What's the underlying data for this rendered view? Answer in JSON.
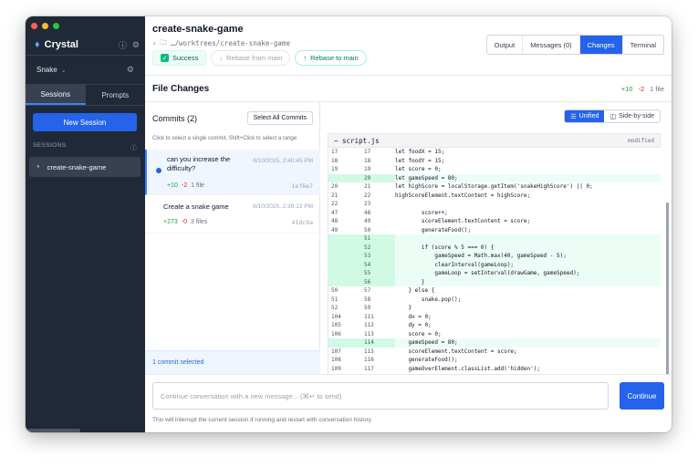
{
  "app": {
    "name": "Crystal",
    "traffic_colors": [
      "#ff5f57",
      "#febc2e",
      "#28c840"
    ],
    "accent": "#2563eb"
  },
  "sidebar": {
    "project": "Snake",
    "tabs": [
      {
        "label": "Sessions",
        "active": true
      },
      {
        "label": "Prompts",
        "active": false
      }
    ],
    "new_session": "New Session",
    "sessions_header": "SESSIONS",
    "sessions": [
      {
        "name": "create-snake-game"
      }
    ]
  },
  "header": {
    "title": "create-snake-game",
    "path": "…/worktrees/create-snake-game",
    "status": "Success",
    "rebase_from": "Rebase from main",
    "rebase_to": "Rebase to main",
    "view_tabs": [
      {
        "label": "Output",
        "active": false
      },
      {
        "label": "Messages (0)",
        "active": false
      },
      {
        "label": "Changes",
        "active": true
      },
      {
        "label": "Terminal",
        "active": false
      }
    ]
  },
  "file_changes": {
    "title": "File Changes",
    "added": "+10",
    "removed": "-2",
    "files": "1 file"
  },
  "commits": {
    "title": "Commits (2)",
    "select_all": "Select All Commits",
    "hint": "Click to select a single commit, Shift+Click to select a range",
    "items": [
      {
        "message": "can you increase the difficulty?",
        "date": "6/10/2025, 2:40:45 PM",
        "added": "+10",
        "removed": "-2",
        "files": "1 file",
        "hash": "1ef6e7",
        "selected": true
      },
      {
        "message": "Create a snake game",
        "date": "6/10/2025, 2:39:13 PM",
        "added": "+273",
        "removed": "-0",
        "files": "3 files",
        "hash": "41dc9a",
        "selected": false
      }
    ],
    "footer": "1 commit selected"
  },
  "diff": {
    "modes": [
      {
        "label": "Unified",
        "active": true
      },
      {
        "label": "Side-by-side",
        "active": false
      }
    ],
    "file": "script.js",
    "file_status": "modified",
    "lines": [
      {
        "old": "17",
        "new": "17",
        "text": "let foodX = 15;",
        "added": false
      },
      {
        "old": "18",
        "new": "18",
        "text": "let foodY = 15;",
        "added": false
      },
      {
        "old": "19",
        "new": "19",
        "text": "let score = 0;",
        "added": false
      },
      {
        "old": "",
        "new": "20",
        "text": "let gameSpeed = 80;",
        "added": true
      },
      {
        "old": "20",
        "new": "21",
        "text": "let highScore = localStorage.getItem('snakeHighScore') || 0;",
        "added": false
      },
      {
        "old": "21",
        "new": "22",
        "text": "highScoreElement.textContent = highScore;",
        "added": false
      },
      {
        "old": "22",
        "new": "23",
        "text": "",
        "added": false
      },
      {
        "old": "47",
        "new": "48",
        "text": "        score++;",
        "added": false
      },
      {
        "old": "48",
        "new": "49",
        "text": "        scoreElement.textContent = score;",
        "added": false
      },
      {
        "old": "49",
        "new": "50",
        "text": "        generateFood();",
        "added": false
      },
      {
        "old": "",
        "new": "51",
        "text": "",
        "added": true
      },
      {
        "old": "",
        "new": "52",
        "text": "        if (score % 5 === 0) {",
        "added": true
      },
      {
        "old": "",
        "new": "53",
        "text": "            gameSpeed = Math.max(40, gameSpeed - 5);",
        "added": true
      },
      {
        "old": "",
        "new": "54",
        "text": "            clearInterval(gameLoop);",
        "added": true
      },
      {
        "old": "",
        "new": "55",
        "text": "            gameLoop = setInterval(drawGame, gameSpeed);",
        "added": true
      },
      {
        "old": "",
        "new": "56",
        "text": "        }",
        "added": true
      },
      {
        "old": "50",
        "new": "57",
        "text": "    } else {",
        "added": false
      },
      {
        "old": "51",
        "new": "58",
        "text": "        snake.pop();",
        "added": false
      },
      {
        "old": "52",
        "new": "59",
        "text": "    }",
        "added": false
      },
      {
        "old": "104",
        "new": "111",
        "text": "    dx = 0;",
        "added": false
      },
      {
        "old": "105",
        "new": "112",
        "text": "    dy = 0;",
        "added": false
      },
      {
        "old": "106",
        "new": "113",
        "text": "    score = 0;",
        "added": false
      },
      {
        "old": "",
        "new": "114",
        "text": "    gameSpeed = 80;",
        "added": true
      },
      {
        "old": "107",
        "new": "115",
        "text": "    scoreElement.textContent = score;",
        "added": false
      },
      {
        "old": "108",
        "new": "116",
        "text": "    generateFood();",
        "added": false
      },
      {
        "old": "109",
        "new": "117",
        "text": "    gameOverElement.classList.add('hidden');",
        "added": false
      }
    ]
  },
  "input": {
    "placeholder": "Continue conversation with a new message... (⌘↵ to send)",
    "button": "Continue",
    "note": "This will interrupt the current session if running and restart with conversation history."
  }
}
